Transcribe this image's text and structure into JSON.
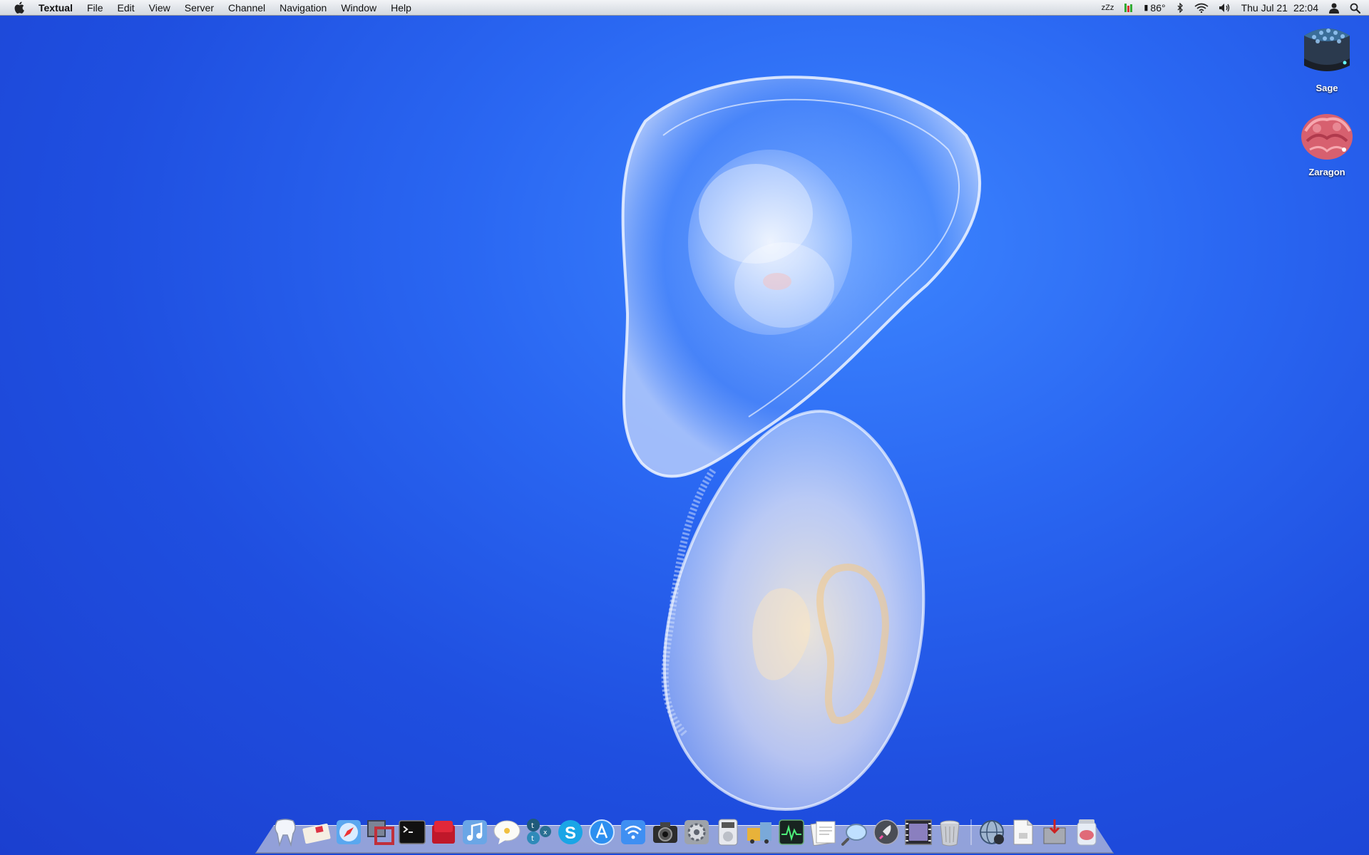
{
  "menubar": {
    "app_name": "Textual",
    "menus": [
      "File",
      "Edit",
      "View",
      "Server",
      "Channel",
      "Navigation",
      "Window",
      "Help"
    ],
    "status": {
      "sleep_indicator": "zZz",
      "temperature": "86°",
      "date": "Thu Jul 21",
      "time": "22:04"
    }
  },
  "desktop": {
    "icons": [
      {
        "name": "Sage",
        "icon": "hard-drive-icon"
      },
      {
        "name": "Zaragon",
        "icon": "brain-drive-icon"
      }
    ]
  },
  "dock": {
    "apps": [
      "finder-tooth-icon",
      "letter-icon",
      "safari-icon",
      "vmware-icon",
      "terminal-icon",
      "flashcard-icon",
      "itunes-icon",
      "adium-icon",
      "tweetdeck-icon",
      "skype-icon",
      "app-store-icon",
      "wifi-icon",
      "camera-icon",
      "system-preferences-icon",
      "dvd-player-icon",
      "transmit-icon",
      "activity-monitor-icon",
      "preview-icon",
      "magnifier-icon",
      "launchpad-icon",
      "photo-booth-icon",
      "trash-can-icon"
    ],
    "docs": [
      "textual-globe-icon",
      "document-icon",
      "installer-icon",
      "brain-jar-icon"
    ]
  },
  "colors": {
    "wallpaper_blue": "#2a67f2",
    "menubar_top": "#f2f4f7",
    "menubar_bottom": "#d3d8df"
  }
}
